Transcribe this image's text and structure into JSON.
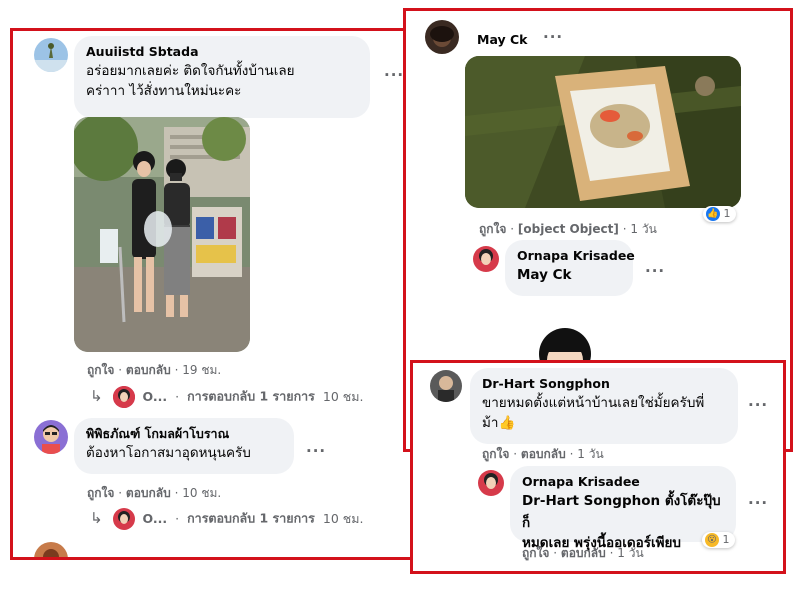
{
  "left_panel": {
    "comments": [
      {
        "author": "Auuiistd Sbtada",
        "text_line1": "อร่อยมากเลยค่ะ ติดใจกันทั้งบ้านเลย",
        "text_line2": "คร่าาา ไว้สั่งทานใหม่นะคะ",
        "like": "ถูกใจ",
        "reply": "ตอบกลับ",
        "time": "19 ชม.",
        "reply_summary_name": "O...",
        "reply_summary": "การตอบกลับ 1 รายการ",
        "reply_summary_time": "10 ชม."
      },
      {
        "author": "พิพิธภัณฑ์ โกมลผ้าโบราณ",
        "text_line1": "ต้องหาโอกาสมาอุดหนุนครับ",
        "like": "ถูกใจ",
        "reply": "ตอบกลับ",
        "time": "10 ชม.",
        "reply_summary_name": "O...",
        "reply_summary": "การตอบกลับ 1 รายการ",
        "reply_summary_time": "10 ชม."
      }
    ]
  },
  "right_top_panel": {
    "author": "May Ck",
    "like": "ถูกใจ",
    "reply": {
      "author": "Ornapa Krisadee",
      "text": "May Ck"
    },
    "time": "1 วัน",
    "reaction_count": "1"
  },
  "right_bottom_panel": {
    "author": "Dr-Hart Songphon",
    "text_line1": "ขายหมดตั้งแต่หน้าบ้านเลยใช่มั้ยครับพี่",
    "text_line2": "ม้า👍",
    "like": "ถูกใจ",
    "reply": "ตอบกลับ",
    "time": "1 วัน",
    "reply_comment": {
      "author": "Ornapa Krisadee",
      "text_line1": "Dr-Hart Songphon ตั้งโต๊ะปุ๊บก็",
      "text_line2": "หมดเลย พรุ่งนี้ออเดอร์เพียบ",
      "like": "ถูกใจ",
      "reply": "ตอบกลับ",
      "time": "1 วัน",
      "reaction_count": "1"
    }
  },
  "ui": {
    "more_glyph": "···",
    "sep": "·",
    "reply_arrow": "↳"
  },
  "colors": {
    "highlight_border": "#d3111b",
    "bubble": "#f0f2f5",
    "meta_text": "#65676b",
    "like_blue": "#1877f2"
  }
}
